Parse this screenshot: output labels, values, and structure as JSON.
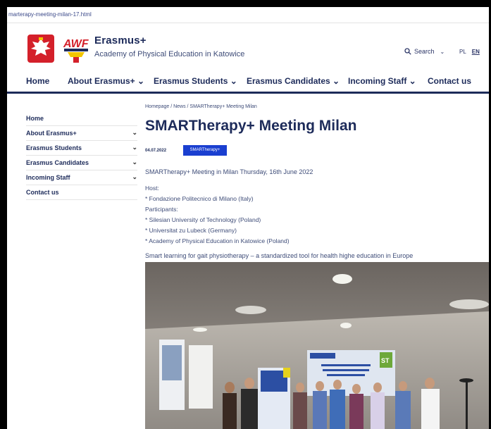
{
  "browser": {
    "url": "marterapy-meeting-milan-17.html"
  },
  "header": {
    "brand_title": "Erasmus+",
    "brand_subtitle": "Academy of Physical Education in Katowice",
    "search_label": "Search",
    "lang_pl": "PL",
    "lang_en": "EN",
    "accent_color": "#1d2b5a",
    "logo_awf_text": "AWF"
  },
  "topnav": {
    "items": [
      "Home",
      "About Erasmus+ ⌄",
      "Erasmus Students ⌄",
      "Erasmus Candidates ⌄",
      "Incoming Staff ⌄",
      "Contact us"
    ]
  },
  "sidebar": {
    "items": [
      {
        "label": "Home",
        "has_submenu": false
      },
      {
        "label": "About Erasmus+",
        "has_submenu": true
      },
      {
        "label": "Erasmus Students",
        "has_submenu": true
      },
      {
        "label": "Erasmus Candidates",
        "has_submenu": true
      },
      {
        "label": "Incoming Staff",
        "has_submenu": true
      },
      {
        "label": "Contact us",
        "has_submenu": false
      }
    ]
  },
  "article": {
    "breadcrumb": "Homepage  /  News  /  SMARTherapy+ Meeting Milan",
    "title": "SMARTherapy+ Meeting Milan",
    "date": "04.07.2022",
    "tag": "SMARTherapy+",
    "tag_color": "#1a3fd0",
    "intro": "SMARTherapy+ Meeting in Milan Thursday, 16th June 2022",
    "lines": [
      "Host:",
      "* Fondazione Politecnico di Milano (Italy)",
      "Participants:",
      "* Silesian University of Technology (Poland)",
      "* Universitat zu Lubeck (Germany)",
      "* Academy of Physical Education in Katowice (Poland)"
    ],
    "smart_line": "Smart learning for gait physiotherapy – a standardized tool for health highe education in Europe",
    "photo_screen_label": "ST"
  }
}
